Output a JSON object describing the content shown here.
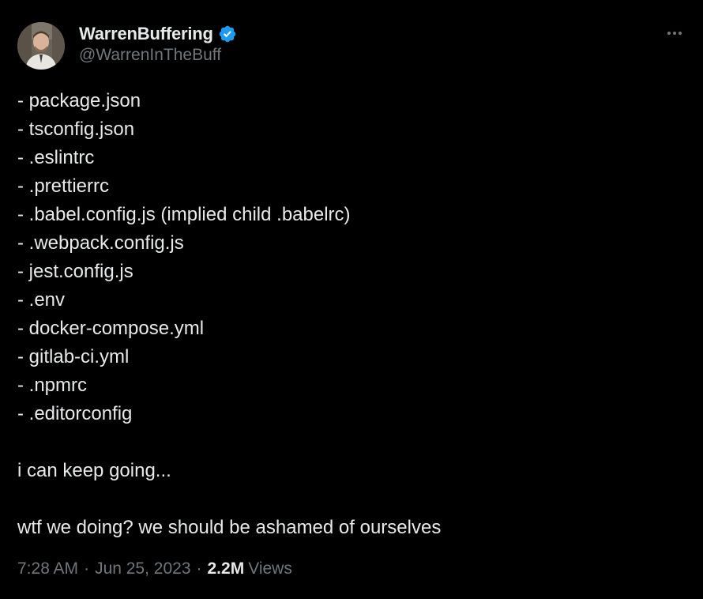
{
  "author": {
    "display_name": "WarrenBuffering",
    "handle": "@WarrenInTheBuff",
    "verified": true,
    "verified_color": "#1d9bf0"
  },
  "icons": {
    "verified": "verified-badge-icon",
    "more": "more-options-icon",
    "avatar": "avatar-photo"
  },
  "tweet": {
    "list_items": [
      "- package.json",
      "- tsconfig.json",
      "- .eslintrc",
      "- .prettierrc",
      "- .babel.config.js (implied child .babelrc)",
      "- .webpack.config.js",
      "- jest.config.js",
      "- .env",
      "- docker-compose.yml",
      "- gitlab-ci.yml",
      "- .npmrc",
      "- .editorconfig"
    ],
    "line_keep_going": "i can keep going...",
    "line_closing": "wtf we doing? we should be ashamed of ourselves"
  },
  "meta": {
    "time": "7:28 AM",
    "separator": "·",
    "date": "Jun 25, 2023",
    "views_count": "2.2M",
    "views_label": "Views"
  },
  "colors": {
    "background": "#000000",
    "text_primary": "#e7e9ea",
    "text_secondary": "#71767b",
    "accent": "#1d9bf0"
  }
}
